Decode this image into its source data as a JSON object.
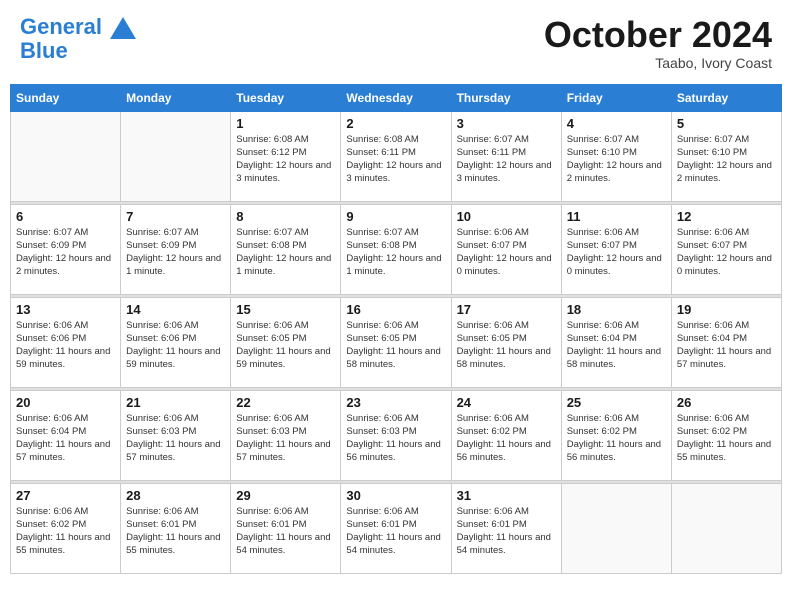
{
  "header": {
    "logo_line1": "General",
    "logo_line2": "Blue",
    "month_title": "October 2024",
    "subtitle": "Taabo, Ivory Coast"
  },
  "weekdays": [
    "Sunday",
    "Monday",
    "Tuesday",
    "Wednesday",
    "Thursday",
    "Friday",
    "Saturday"
  ],
  "weeks": [
    [
      {
        "day": "",
        "info": ""
      },
      {
        "day": "",
        "info": ""
      },
      {
        "day": "1",
        "info": "Sunrise: 6:08 AM\nSunset: 6:12 PM\nDaylight: 12 hours and 3 minutes."
      },
      {
        "day": "2",
        "info": "Sunrise: 6:08 AM\nSunset: 6:11 PM\nDaylight: 12 hours and 3 minutes."
      },
      {
        "day": "3",
        "info": "Sunrise: 6:07 AM\nSunset: 6:11 PM\nDaylight: 12 hours and 3 minutes."
      },
      {
        "day": "4",
        "info": "Sunrise: 6:07 AM\nSunset: 6:10 PM\nDaylight: 12 hours and 2 minutes."
      },
      {
        "day": "5",
        "info": "Sunrise: 6:07 AM\nSunset: 6:10 PM\nDaylight: 12 hours and 2 minutes."
      }
    ],
    [
      {
        "day": "6",
        "info": "Sunrise: 6:07 AM\nSunset: 6:09 PM\nDaylight: 12 hours and 2 minutes."
      },
      {
        "day": "7",
        "info": "Sunrise: 6:07 AM\nSunset: 6:09 PM\nDaylight: 12 hours and 1 minute."
      },
      {
        "day": "8",
        "info": "Sunrise: 6:07 AM\nSunset: 6:08 PM\nDaylight: 12 hours and 1 minute."
      },
      {
        "day": "9",
        "info": "Sunrise: 6:07 AM\nSunset: 6:08 PM\nDaylight: 12 hours and 1 minute."
      },
      {
        "day": "10",
        "info": "Sunrise: 6:06 AM\nSunset: 6:07 PM\nDaylight: 12 hours and 0 minutes."
      },
      {
        "day": "11",
        "info": "Sunrise: 6:06 AM\nSunset: 6:07 PM\nDaylight: 12 hours and 0 minutes."
      },
      {
        "day": "12",
        "info": "Sunrise: 6:06 AM\nSunset: 6:07 PM\nDaylight: 12 hours and 0 minutes."
      }
    ],
    [
      {
        "day": "13",
        "info": "Sunrise: 6:06 AM\nSunset: 6:06 PM\nDaylight: 11 hours and 59 minutes."
      },
      {
        "day": "14",
        "info": "Sunrise: 6:06 AM\nSunset: 6:06 PM\nDaylight: 11 hours and 59 minutes."
      },
      {
        "day": "15",
        "info": "Sunrise: 6:06 AM\nSunset: 6:05 PM\nDaylight: 11 hours and 59 minutes."
      },
      {
        "day": "16",
        "info": "Sunrise: 6:06 AM\nSunset: 6:05 PM\nDaylight: 11 hours and 58 minutes."
      },
      {
        "day": "17",
        "info": "Sunrise: 6:06 AM\nSunset: 6:05 PM\nDaylight: 11 hours and 58 minutes."
      },
      {
        "day": "18",
        "info": "Sunrise: 6:06 AM\nSunset: 6:04 PM\nDaylight: 11 hours and 58 minutes."
      },
      {
        "day": "19",
        "info": "Sunrise: 6:06 AM\nSunset: 6:04 PM\nDaylight: 11 hours and 57 minutes."
      }
    ],
    [
      {
        "day": "20",
        "info": "Sunrise: 6:06 AM\nSunset: 6:04 PM\nDaylight: 11 hours and 57 minutes."
      },
      {
        "day": "21",
        "info": "Sunrise: 6:06 AM\nSunset: 6:03 PM\nDaylight: 11 hours and 57 minutes."
      },
      {
        "day": "22",
        "info": "Sunrise: 6:06 AM\nSunset: 6:03 PM\nDaylight: 11 hours and 57 minutes."
      },
      {
        "day": "23",
        "info": "Sunrise: 6:06 AM\nSunset: 6:03 PM\nDaylight: 11 hours and 56 minutes."
      },
      {
        "day": "24",
        "info": "Sunrise: 6:06 AM\nSunset: 6:02 PM\nDaylight: 11 hours and 56 minutes."
      },
      {
        "day": "25",
        "info": "Sunrise: 6:06 AM\nSunset: 6:02 PM\nDaylight: 11 hours and 56 minutes."
      },
      {
        "day": "26",
        "info": "Sunrise: 6:06 AM\nSunset: 6:02 PM\nDaylight: 11 hours and 55 minutes."
      }
    ],
    [
      {
        "day": "27",
        "info": "Sunrise: 6:06 AM\nSunset: 6:02 PM\nDaylight: 11 hours and 55 minutes."
      },
      {
        "day": "28",
        "info": "Sunrise: 6:06 AM\nSunset: 6:01 PM\nDaylight: 11 hours and 55 minutes."
      },
      {
        "day": "29",
        "info": "Sunrise: 6:06 AM\nSunset: 6:01 PM\nDaylight: 11 hours and 54 minutes."
      },
      {
        "day": "30",
        "info": "Sunrise: 6:06 AM\nSunset: 6:01 PM\nDaylight: 11 hours and 54 minutes."
      },
      {
        "day": "31",
        "info": "Sunrise: 6:06 AM\nSunset: 6:01 PM\nDaylight: 11 hours and 54 minutes."
      },
      {
        "day": "",
        "info": ""
      },
      {
        "day": "",
        "info": ""
      }
    ]
  ]
}
